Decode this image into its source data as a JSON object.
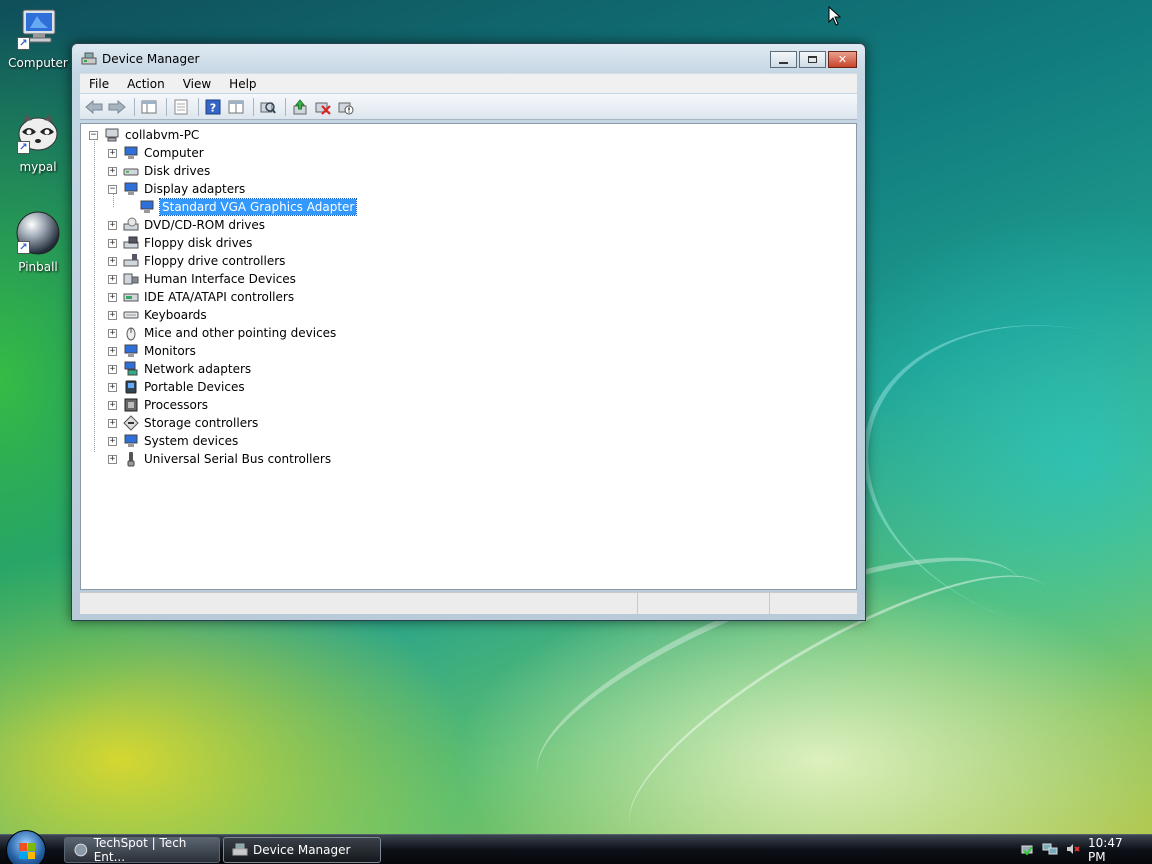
{
  "desktop": {
    "icons": [
      {
        "label": "Computer",
        "icon": "computer-icon"
      },
      {
        "label": "mypal",
        "icon": "raccoon-icon"
      },
      {
        "label": "Pinball",
        "icon": "pinball-icon"
      }
    ]
  },
  "window": {
    "title": "Device Manager",
    "menu": [
      "File",
      "Action",
      "View",
      "Help"
    ],
    "toolbar_icons": [
      "back-icon",
      "forward-icon",
      "show-hide-icon",
      "properties-icon",
      "help-icon",
      "view-icon",
      "scan-hardware-icon",
      "update-driver-icon",
      "uninstall-icon",
      "disable-icon"
    ]
  },
  "tree": {
    "root": "collabvm-PC",
    "items": [
      {
        "label": "Computer",
        "expanded": false
      },
      {
        "label": "Disk drives",
        "expanded": false
      },
      {
        "label": "Display adapters",
        "expanded": true,
        "children": [
          "Standard VGA Graphics Adapter"
        ]
      },
      {
        "label": "DVD/CD-ROM drives",
        "expanded": false
      },
      {
        "label": "Floppy disk drives",
        "expanded": false
      },
      {
        "label": "Floppy drive controllers",
        "expanded": false
      },
      {
        "label": "Human Interface Devices",
        "expanded": false
      },
      {
        "label": "IDE ATA/ATAPI controllers",
        "expanded": false
      },
      {
        "label": "Keyboards",
        "expanded": false
      },
      {
        "label": "Mice and other pointing devices",
        "expanded": false
      },
      {
        "label": "Monitors",
        "expanded": false
      },
      {
        "label": "Network adapters",
        "expanded": false
      },
      {
        "label": "Portable Devices",
        "expanded": false
      },
      {
        "label": "Processors",
        "expanded": false
      },
      {
        "label": "Storage controllers",
        "expanded": false
      },
      {
        "label": "System devices",
        "expanded": false
      },
      {
        "label": "Universal Serial Bus controllers",
        "expanded": false
      }
    ],
    "selected": "Standard VGA Graphics Adapter"
  },
  "taskbar": {
    "buttons": [
      {
        "label": "TechSpot | Tech Ent...",
        "active": false
      },
      {
        "label": "Device Manager",
        "active": true
      }
    ],
    "clock": "10:47 PM"
  },
  "colors": {
    "selection": "#3399ff",
    "close_button": "#c7452b"
  }
}
